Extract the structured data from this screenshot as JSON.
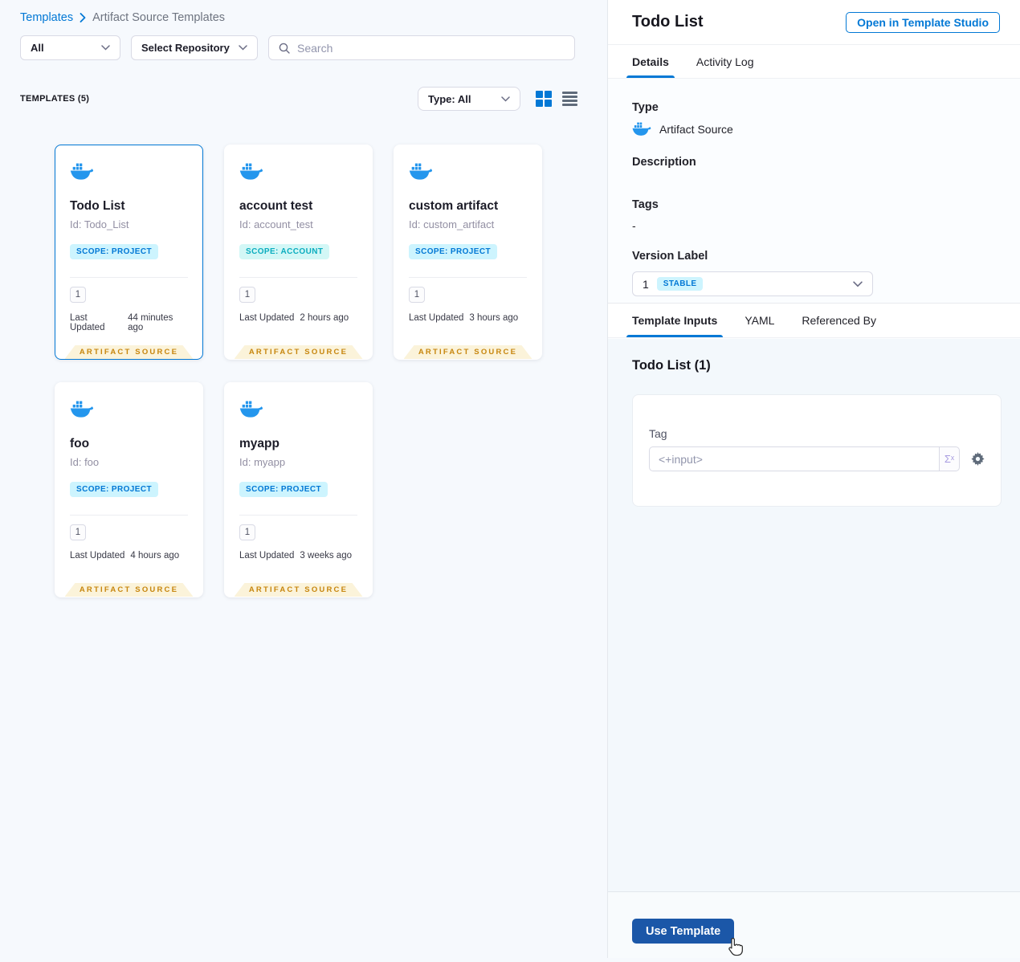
{
  "breadcrumb": {
    "templates_link": "Templates",
    "current": "Artifact Source Templates"
  },
  "filters": {
    "scope": "All",
    "repository": "Select Repository",
    "search_placeholder": "Search"
  },
  "list_header": {
    "count_label": "TEMPLATES (5)",
    "type_filter": "Type: All"
  },
  "cards": [
    {
      "title": "Todo List",
      "id": "Id: Todo_List",
      "scope": "SCOPE: PROJECT",
      "version": "1",
      "updated_label": "Last Updated",
      "updated": "44 minutes ago",
      "ribbon": "ARTIFACT SOURCE"
    },
    {
      "title": "account test",
      "id": "Id: account_test",
      "scope": "SCOPE: ACCOUNT",
      "version": "1",
      "updated_label": "Last Updated",
      "updated": "2 hours ago",
      "ribbon": "ARTIFACT SOURCE"
    },
    {
      "title": "custom artifact",
      "id": "Id: custom_artifact",
      "scope": "SCOPE: PROJECT",
      "version": "1",
      "updated_label": "Last Updated",
      "updated": "3 hours ago",
      "ribbon": "ARTIFACT SOURCE"
    },
    {
      "title": "foo",
      "id": "Id: foo",
      "scope": "SCOPE: PROJECT",
      "version": "1",
      "updated_label": "Last Updated",
      "updated": "4 hours ago",
      "ribbon": "ARTIFACT SOURCE"
    },
    {
      "title": "myapp",
      "id": "Id: myapp",
      "scope": "SCOPE: PROJECT",
      "version": "1",
      "updated_label": "Last Updated",
      "updated": "3 weeks ago",
      "ribbon": "ARTIFACT SOURCE"
    }
  ],
  "panel": {
    "title": "Todo List",
    "open_studio": "Open in Template Studio",
    "tabs": {
      "details": "Details",
      "activity": "Activity Log"
    },
    "fields": {
      "type_label": "Type",
      "type_value": "Artifact Source",
      "description_label": "Description",
      "tags_label": "Tags",
      "tags_value": "-",
      "version_label": "Version Label",
      "version_value": "1",
      "version_badge": "STABLE"
    },
    "inner_tabs": {
      "inputs": "Template Inputs",
      "yaml": "YAML",
      "referenced": "Referenced By"
    },
    "inputs": {
      "title": "Todo List (1)",
      "tag_label": "Tag",
      "tag_value": "<+input>",
      "sigma": "Σˣ"
    },
    "footer": {
      "use_template": "Use Template"
    }
  },
  "colors": {
    "primary": "#0278D5",
    "docker_blue": "#2496ED",
    "ribbon_bg": "#FBF3DA",
    "ribbon_text": "#C7860E",
    "scope_project_bg": "#CDF4FE",
    "scope_account_bg": "#D3F7F6",
    "scope_account_text": "#0BADBF",
    "use_template_bg": "#1B57A8"
  }
}
